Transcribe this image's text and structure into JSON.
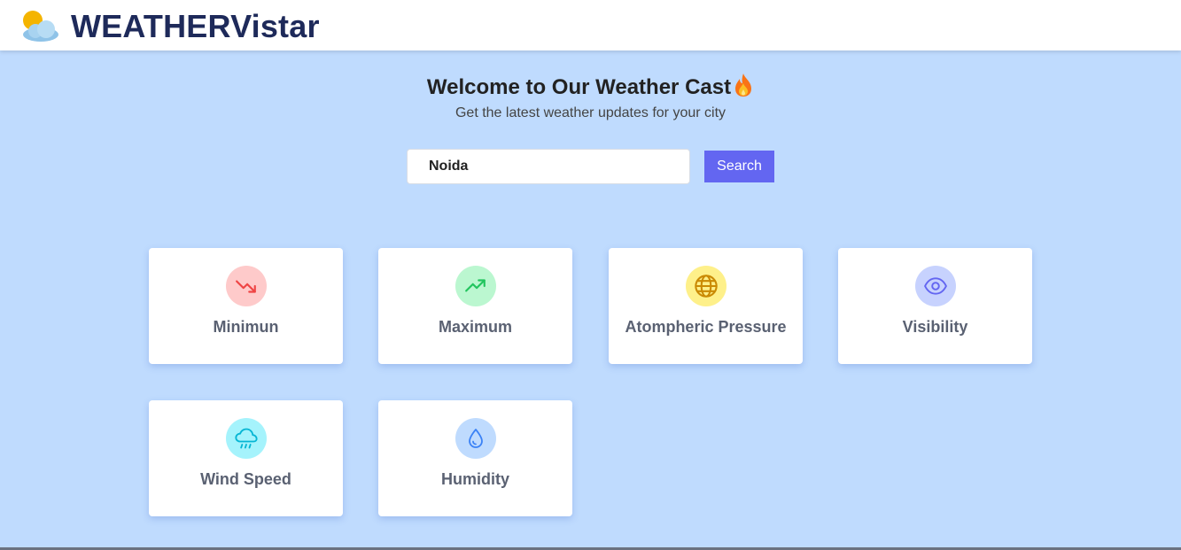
{
  "navbar": {
    "brand": "WEATHERVistar",
    "logo_icon": "sun-behind-cloud-icon"
  },
  "hero": {
    "title": "Welcome to Our Weather Cast",
    "title_emoji": "fire-icon",
    "subtitle": "Get the latest weather updates for your city"
  },
  "search": {
    "value": "Noida",
    "button_label": "Search"
  },
  "cards": [
    {
      "label": "Minimun",
      "icon": "trending-down-icon",
      "icon_bg": "#fecaca",
      "icon_color": "#ef4444"
    },
    {
      "label": "Maximum",
      "icon": "trending-up-icon",
      "icon_bg": "#bbf7d0",
      "icon_color": "#22c55e"
    },
    {
      "label": "Atompheric Pressure",
      "icon": "globe-icon",
      "icon_bg": "#fef08a",
      "icon_color": "#ca8a04"
    },
    {
      "label": "Visibility",
      "icon": "eye-icon",
      "icon_bg": "#c7d2fe",
      "icon_color": "#6366f1"
    },
    {
      "label": "Wind Speed",
      "icon": "cloud-rain-icon",
      "icon_bg": "#a5f3fc",
      "icon_color": "#06b6d4"
    },
    {
      "label": "Humidity",
      "icon": "droplet-icon",
      "icon_bg": "#bfdbfe",
      "icon_color": "#3b82f6"
    }
  ],
  "colors": {
    "page_bg": "#bfdbfe",
    "brand_text": "#1e2a5a",
    "button_bg": "#6366f1"
  }
}
